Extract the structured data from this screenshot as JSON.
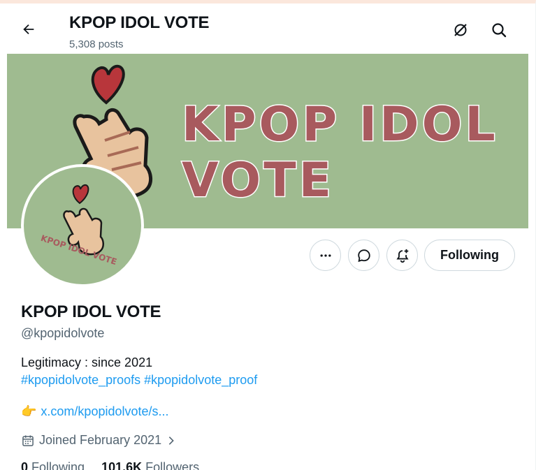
{
  "header": {
    "title": "KPOP IDOL VOTE",
    "posts_count": "5,308 posts",
    "back_icon": "arrow-left-icon",
    "grok_icon": "grok-icon",
    "search_icon": "search-icon"
  },
  "banner": {
    "line1": "KPOP IDOL",
    "line2": "VOTE",
    "bg_color": "#9fbb90",
    "text_color": "#a85a5e"
  },
  "avatar": {
    "text": "KPOP IDOL VOTE"
  },
  "actions": {
    "more_icon": "more-icon",
    "message_icon": "message-icon",
    "notify_icon": "bell-plus-icon",
    "following_label": "Following"
  },
  "profile": {
    "name": "KPOP IDOL VOTE",
    "handle": "@kpopidolvote",
    "bio_line1": "Legitimacy : since 2021",
    "hashtag1": "#kpopidolvote_proofs",
    "hashtag2": "#kpopidolvote_proof",
    "link_emoji": "👉",
    "link_text": "x.com/kpopidolvote/s...",
    "joined": "Joined February 2021",
    "following_count": "0",
    "following_label": "Following",
    "followers_count": "101.6K",
    "followers_label": "Followers"
  },
  "colors": {
    "accent_blue": "#1d9bf0",
    "muted_text": "#536471",
    "heart_red": "#b8363b"
  }
}
